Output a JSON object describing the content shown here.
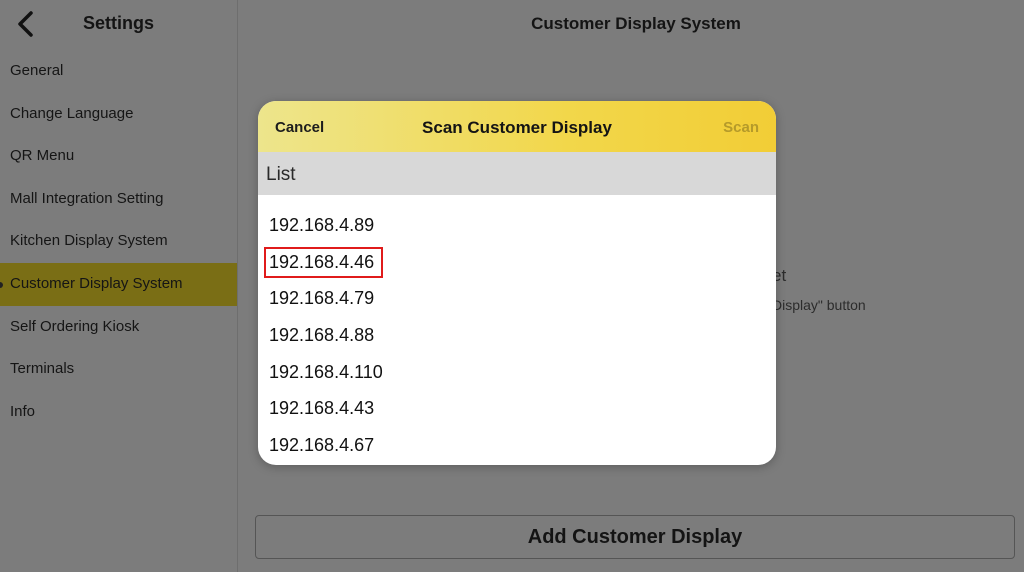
{
  "sidebar": {
    "title": "Settings",
    "items": [
      {
        "label": "General"
      },
      {
        "label": "Change Language"
      },
      {
        "label": "QR Menu"
      },
      {
        "label": "Mall Integration Setting"
      },
      {
        "label": "Kitchen Display System"
      },
      {
        "label": "Customer Display System",
        "active": true
      },
      {
        "label": "Self Ordering Kiosk"
      },
      {
        "label": "Terminals"
      },
      {
        "label": "Info"
      }
    ]
  },
  "main": {
    "title": "Customer Display System",
    "hint_line1": "et",
    "hint_line2": "Display\" button",
    "add_button_label": "Add Customer Display"
  },
  "modal": {
    "cancel_label": "Cancel",
    "title": "Scan Customer Display",
    "scan_label": "Scan",
    "list_header": "List",
    "items": [
      "192.168.4.89",
      "192.168.4.46",
      "192.168.4.79",
      "192.168.4.88",
      "192.168.4.110",
      "192.168.4.43",
      "192.168.4.67"
    ],
    "highlighted_index": 1
  },
  "colors": {
    "overlay_dim": "#7c7c7c",
    "active_item": "#7a6e15",
    "header_gradient_start": "#ede58c",
    "header_gradient_end": "#f2cd36",
    "highlight_border": "#e01b1b"
  }
}
